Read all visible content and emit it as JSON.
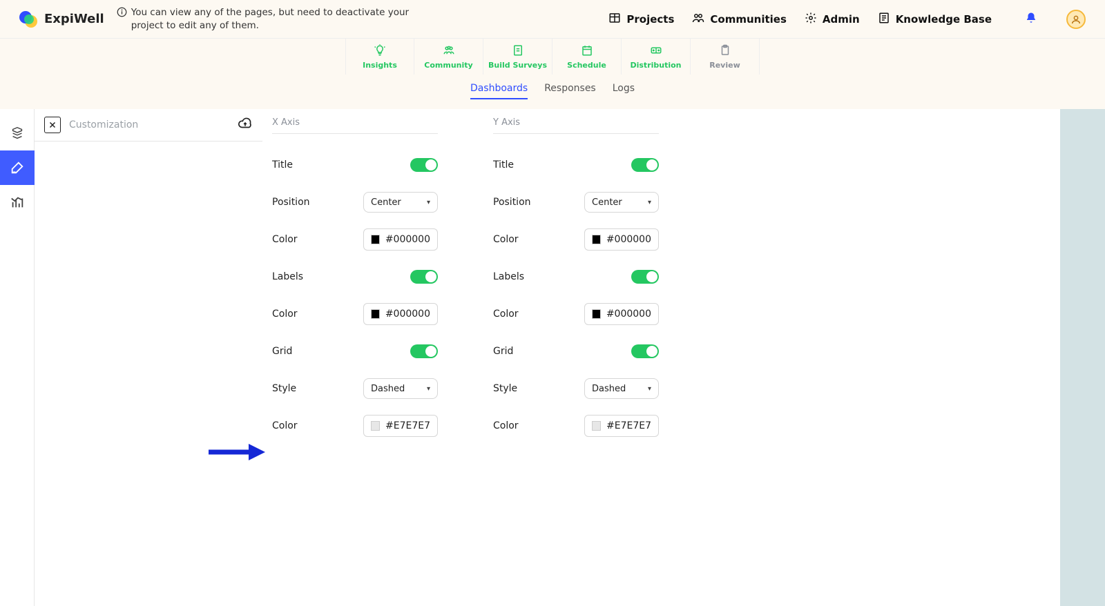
{
  "brand": "ExpiWell",
  "info_text": "You can view any of the pages, but need to deactivate your project to edit any of them.",
  "top_nav": {
    "projects": "Projects",
    "communities": "Communities",
    "admin": "Admin",
    "kb": "Knowledge Base"
  },
  "project_tabs": {
    "insights": "Insights",
    "community": "Community",
    "build": "Build Surveys",
    "schedule": "Schedule",
    "distribution": "Distribution",
    "review": "Review"
  },
  "sub_tabs": {
    "dashboards": "Dashboards",
    "responses": "Responses",
    "logs": "Logs"
  },
  "customization_label": "Customization",
  "x_axis": {
    "header": "X Axis",
    "title": "Title",
    "position": "Position",
    "position_value": "Center",
    "color": "Color",
    "title_color": "#000000",
    "labels": "Labels",
    "labels_color": "#000000",
    "grid": "Grid",
    "style": "Style",
    "style_value": "Dashed",
    "grid_color": "#E7E7E7"
  },
  "y_axis": {
    "header": "Y Axis",
    "title": "Title",
    "position": "Position",
    "position_value": "Center",
    "color": "Color",
    "title_color": "#000000",
    "labels": "Labels",
    "labels_color": "#000000",
    "grid": "Grid",
    "style": "Style",
    "style_value": "Dashed",
    "grid_color": "#E7E7E7"
  }
}
